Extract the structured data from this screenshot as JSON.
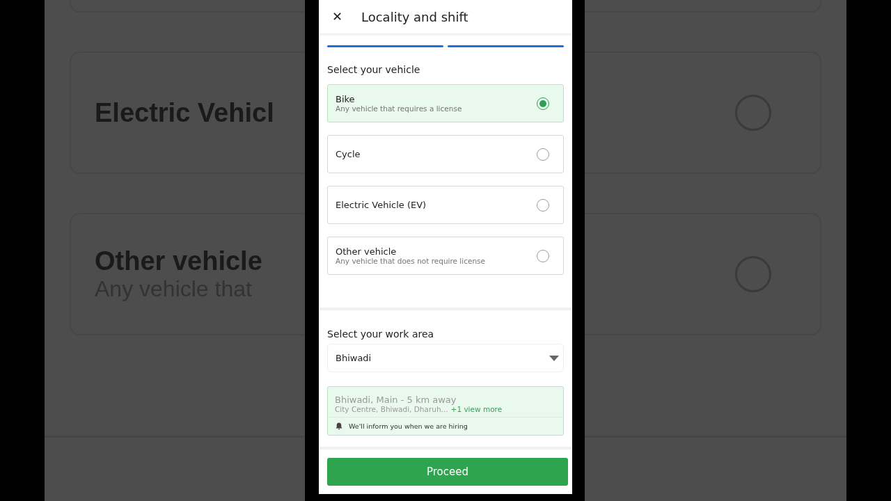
{
  "backdrop": {
    "options": [
      {
        "label": "Electric Vehicl",
        "selected": false
      },
      {
        "label": "Other vehicle",
        "description": "Any vehicle that",
        "selected": false
      }
    ]
  },
  "header": {
    "close": "✕",
    "title": "Locality and shift"
  },
  "steps": [
    {
      "done": true
    },
    {
      "done": true
    }
  ],
  "vehicle_section": {
    "title": "Select your vehicle",
    "options": [
      {
        "label": "Bike",
        "description": "Any vehicle that requires a license",
        "selected": true
      },
      {
        "label": "Cycle",
        "selected": false
      },
      {
        "label": "Electric Vehicle (EV)",
        "selected": false
      },
      {
        "label": "Other vehicle",
        "description": "Any vehicle that does not require license",
        "selected": false
      }
    ]
  },
  "work_area": {
    "title": "Select your work area",
    "value": "Bhiwadi",
    "location": {
      "name": "Bhiwadi, Main - 5 km away",
      "areas": "City Centre, Bhiwadi, Dharuh...",
      "more": "+1 view more",
      "notice": "We'll inform you when we are hiring"
    }
  },
  "proceed_button": "Proceed"
}
